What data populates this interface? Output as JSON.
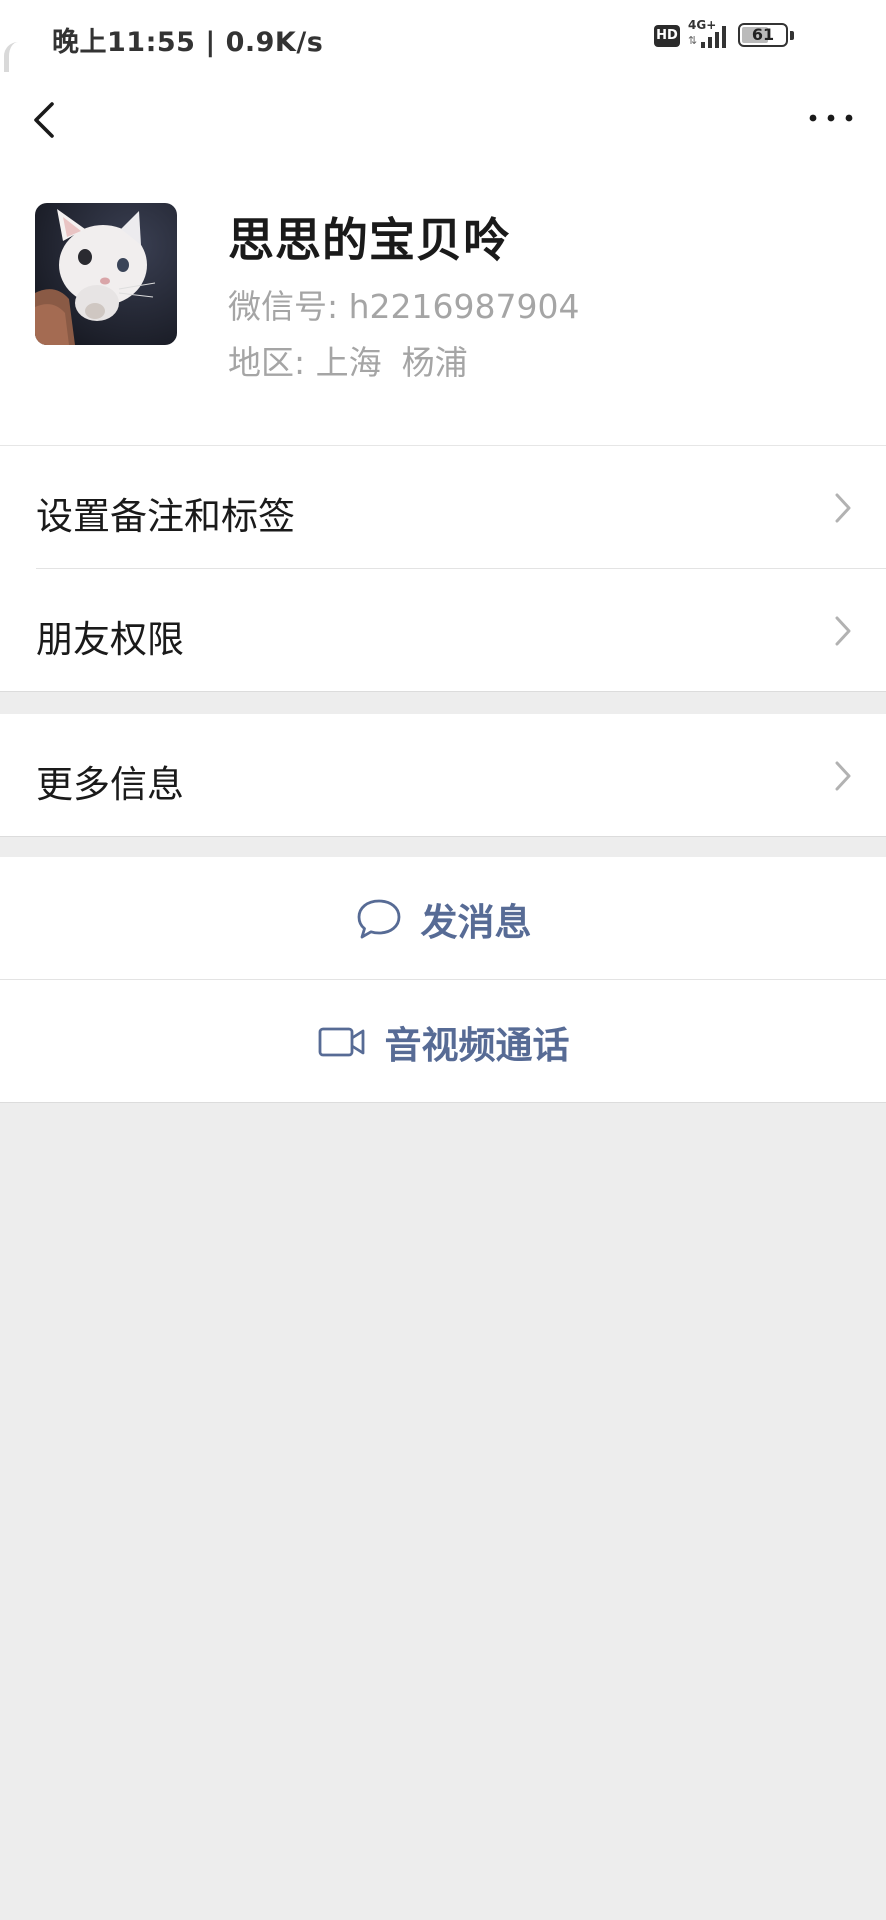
{
  "status_bar": {
    "time_speed": "晚上11:55 | 0.9K/s",
    "hd_label": "HD",
    "network_type": "4G+",
    "battery_level": "61"
  },
  "profile": {
    "name": "思思的宝贝呤",
    "wechat_id_label": "微信号:",
    "wechat_id": "h2216987904",
    "region_label": "地区:",
    "region_province": "上海",
    "region_city": "杨浦"
  },
  "menu": {
    "set_remark": "设置备注和标签",
    "friend_permissions": "朋友权限",
    "more_info": "更多信息"
  },
  "actions": {
    "send_message": "发消息",
    "video_call": "音视频通话"
  },
  "colors": {
    "accent_link": "#576b95",
    "background": "#ededed"
  },
  "icons": [
    "back-arrow-icon",
    "more-dots-icon",
    "chevron-right-icon",
    "chat-bubble-icon",
    "video-camera-icon"
  ]
}
